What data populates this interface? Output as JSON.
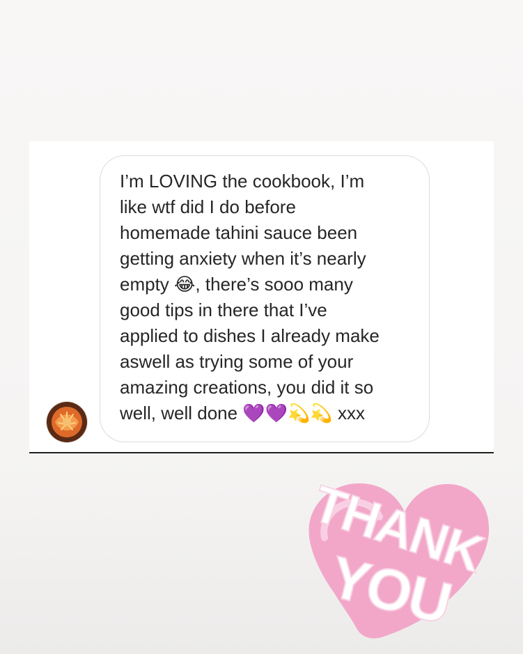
{
  "message": {
    "text": "I’m LOVING the cookbook, I’m\nlike wtf did I do before\nhomemade tahini sauce been\ngetting anxiety when it’s nearly\nempty 😂, there’s sooo many\ngood tips in there that I’ve\napplied to dishes I already make\naswell as trying some of your\namazing creations, you did it so\nwell, well done 💜💜💫💫 xxx"
  },
  "sticker": {
    "line1": "THANK",
    "line2": "YOU"
  },
  "colors": {
    "page_background": "#f7f6f5",
    "bubble_border": "#dcdcdc",
    "message_text": "#262626",
    "heart_pink": "#f2a7c9",
    "sticker_text": "#ffffff"
  },
  "icons": {
    "avatar": "profile-avatar",
    "sticker": "thank-you-heart-sticker"
  }
}
